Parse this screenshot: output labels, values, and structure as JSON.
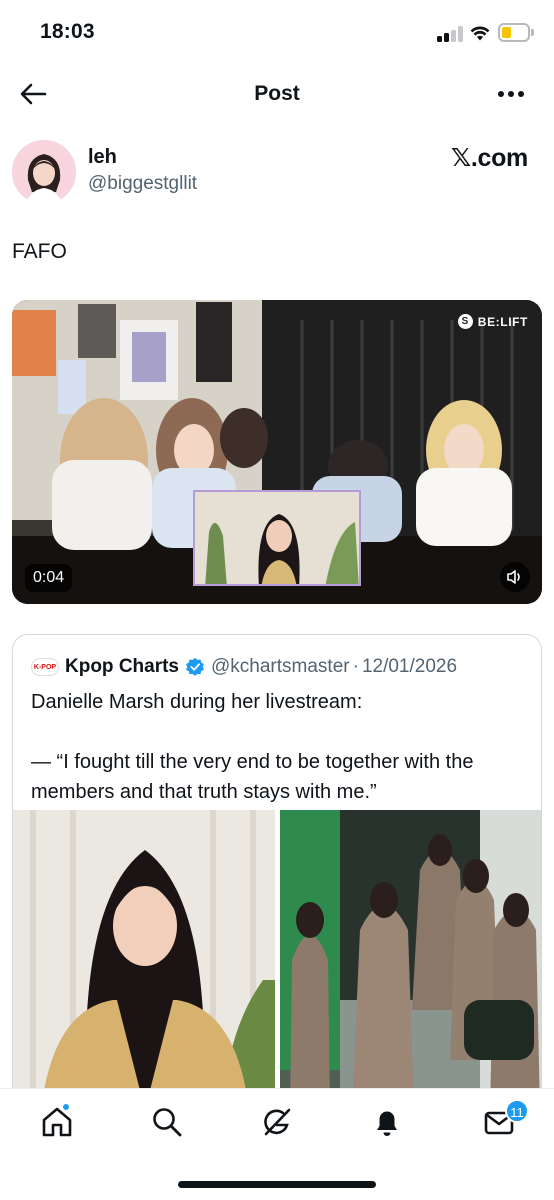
{
  "status_bar": {
    "time": "18:03",
    "battery_color": "#f5c400"
  },
  "header": {
    "title": "Post",
    "back_icon": "arrow-left-icon",
    "more_icon": "ellipsis-icon"
  },
  "post": {
    "author": {
      "name": "leh",
      "handle": "@biggestgllit"
    },
    "source": "𝕏.com",
    "text": "FAFO",
    "video": {
      "duration": "0:04",
      "watermark": "BE:LIFT"
    }
  },
  "quote": {
    "logo_text": "K-POP",
    "name": "Kpop Charts",
    "verified": true,
    "handle": "@kchartsmaster",
    "separator": "·",
    "date": "12/01/2026",
    "lines": [
      "Danielle Marsh during her livestream:",
      "— “I fought till the very end to be together with the members and that truth stays with me.”"
    ]
  },
  "nav": {
    "items": [
      "home-icon",
      "search-icon",
      "grok-icon",
      "notifications-icon",
      "messages-icon"
    ],
    "messages_badge": "11",
    "accent": "#1d9bf0"
  }
}
